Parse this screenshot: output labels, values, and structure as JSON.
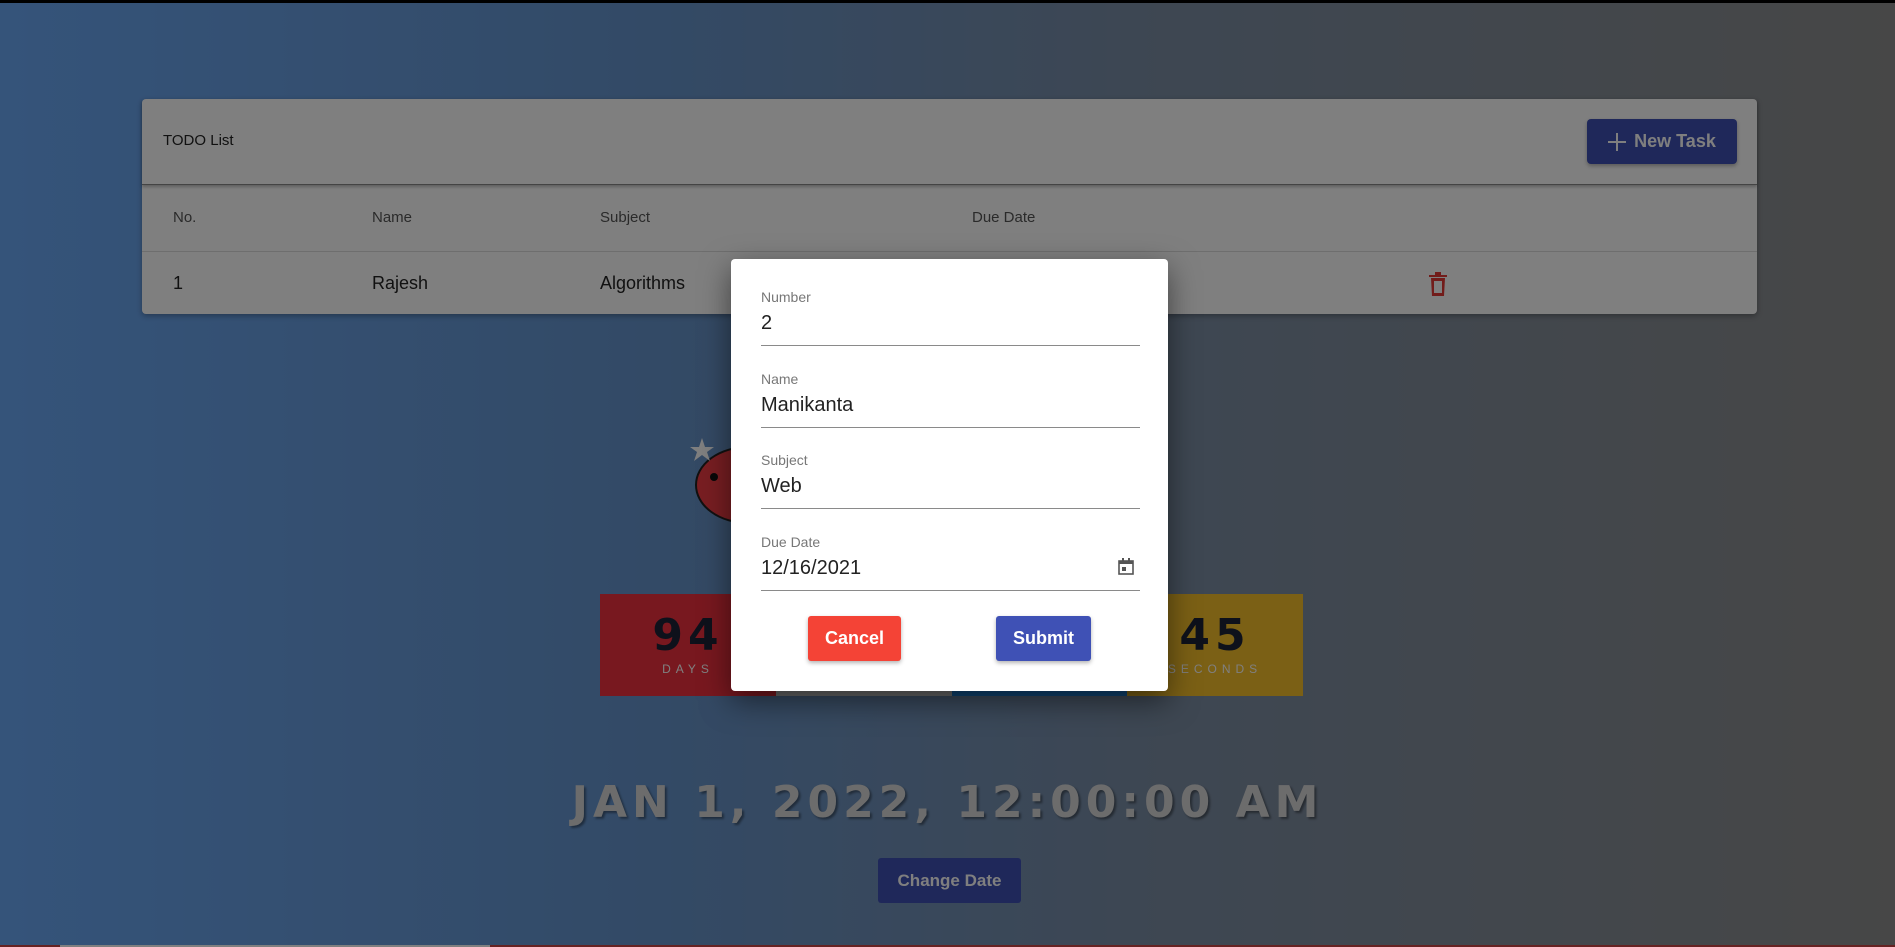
{
  "todo": {
    "title": "TODO List",
    "new_task_label": "New Task",
    "columns": [
      "No.",
      "Name",
      "Subject",
      "Due Date"
    ],
    "rows": [
      {
        "no": "1",
        "name": "Rajesh",
        "subject": "Algorithms"
      }
    ]
  },
  "countdown": {
    "days": {
      "value": "94",
      "label": "DAYS"
    },
    "seconds": {
      "value": "45",
      "label": "SECONDS"
    },
    "target_date": "JAN 1, 2022, 12:00:00 AM",
    "change_date_label": "Change Date"
  },
  "dialog": {
    "number": {
      "label": "Number",
      "value": "2"
    },
    "name": {
      "label": "Name",
      "value": "Manikanta"
    },
    "subject": {
      "label": "Subject",
      "value": "Web"
    },
    "due_date": {
      "label": "Due Date",
      "value": "12/16/2021"
    },
    "cancel_label": "Cancel",
    "submit_label": "Submit"
  },
  "colors": {
    "primary": "#3f51b5",
    "danger": "#f44336"
  },
  "icons": [
    "plus-icon",
    "trash-icon",
    "calendar-icon",
    "tomato-mascot"
  ]
}
